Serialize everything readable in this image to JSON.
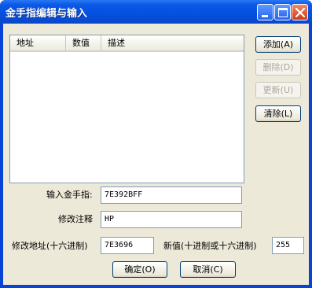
{
  "window": {
    "title": "金手指编辑与输入"
  },
  "list": {
    "columns": [
      "地址",
      "数值",
      "描述"
    ],
    "rows": []
  },
  "buttons": {
    "add": "添加(A)",
    "delete": "删除(D)",
    "update": "更新(U)",
    "clear": "清除(L)",
    "ok": "确定(O)",
    "cancel": "取消(C)"
  },
  "fields": {
    "code_label": "输入金手指:",
    "code_value": "7E392BFF",
    "comment_label": "修改注释",
    "comment_value": "HP",
    "address_label": "修改地址(十六进制)",
    "address_value": "7E3696",
    "newvalue_label": "新值(十进制或十六进制)",
    "newvalue_value": "255"
  },
  "colors": {
    "titlebar": "#0550df",
    "dialog_bg": "#ece9d8",
    "close_button": "#cf3a14"
  }
}
